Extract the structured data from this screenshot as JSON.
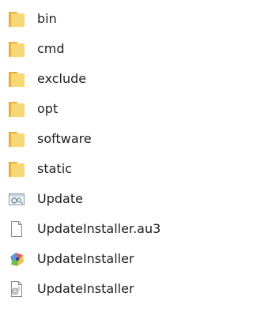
{
  "explorer": {
    "items": [
      {
        "label": "bin",
        "icon": "folder-icon"
      },
      {
        "label": "cmd",
        "icon": "folder-icon"
      },
      {
        "label": "exclude",
        "icon": "folder-icon"
      },
      {
        "label": "opt",
        "icon": "folder-icon"
      },
      {
        "label": "software",
        "icon": "folder-icon"
      },
      {
        "label": "static",
        "icon": "folder-icon"
      },
      {
        "label": "Update",
        "icon": "config-file-icon"
      },
      {
        "label": "UpdateInstaller.au3",
        "icon": "blank-document-icon"
      },
      {
        "label": "UpdateInstaller",
        "icon": "application-icon"
      },
      {
        "label": "UpdateInstaller",
        "icon": "script-file-icon"
      }
    ]
  },
  "colors": {
    "folder_back": "#e8b03b",
    "folder_front": "#f8d775",
    "text": "#1e1e1e"
  }
}
